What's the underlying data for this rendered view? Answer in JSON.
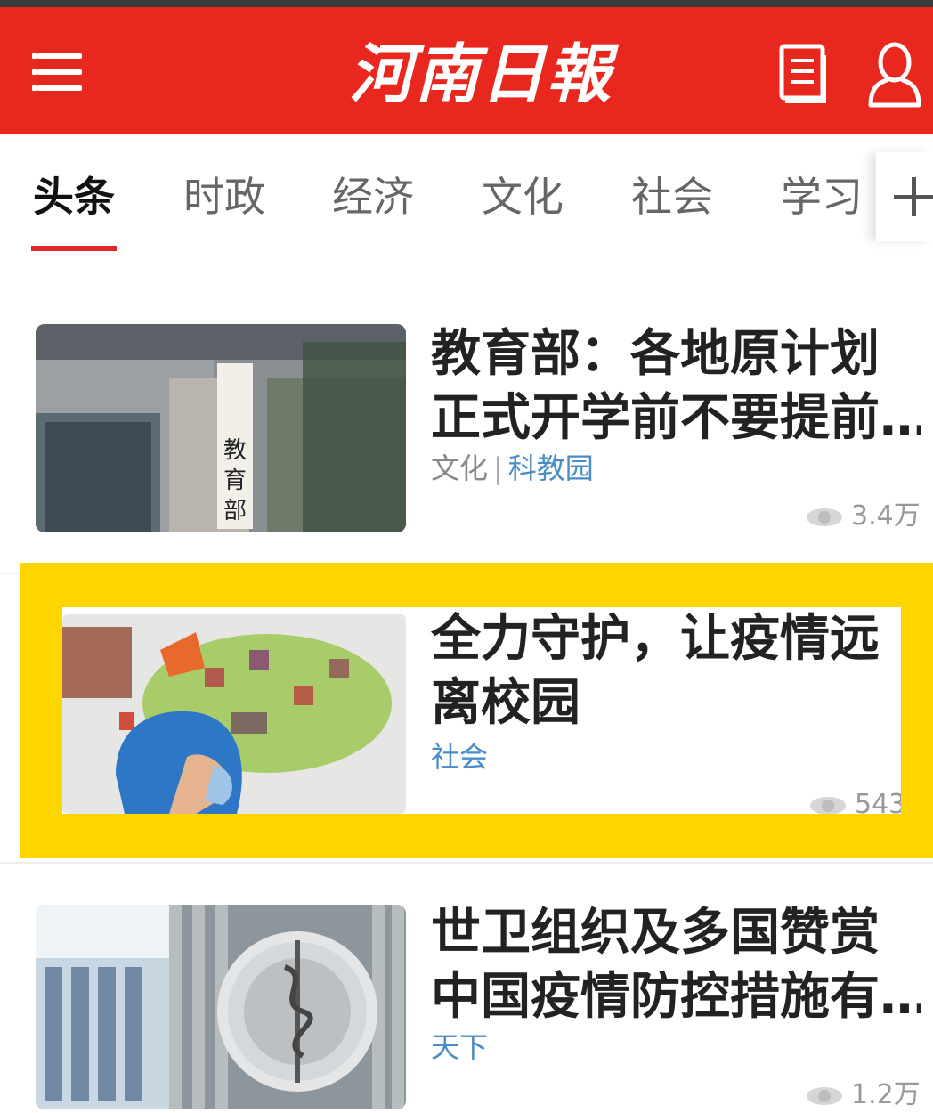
{
  "header": {
    "logo": "河南日報",
    "menu_icon": "hamburger-menu-icon",
    "news_icon": "newspaper-icon",
    "user_icon": "user-profile-icon",
    "background": "#e8281f"
  },
  "tabs": [
    {
      "label": "头条",
      "active": true
    },
    {
      "label": "时政",
      "active": false
    },
    {
      "label": "经济",
      "active": false
    },
    {
      "label": "文化",
      "active": false
    },
    {
      "label": "社会",
      "active": false
    },
    {
      "label": "学习",
      "active": false
    }
  ],
  "tab_add_icon": "plus-icon",
  "articles": [
    {
      "title_line1": "教育部：各地原计划",
      "title_line2": "正式开学前不要提前…",
      "category": "文化",
      "subcategory": "科教园",
      "views": "3.4万"
    },
    {
      "title_line1": "全力守护，让疫情远",
      "title_line2": "离校园",
      "category": "社会",
      "views": "543",
      "highlighted": true
    },
    {
      "title_line1": "世卫组织及多国赞赏",
      "title_line2": "中国疫情防控措施有…",
      "category": "天下",
      "views": "1.2万"
    }
  ],
  "highlight_color": "#fdd600"
}
